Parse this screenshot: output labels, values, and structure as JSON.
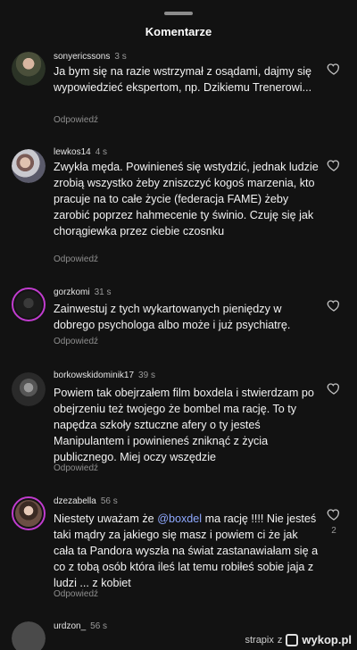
{
  "sheet": {
    "title": "Komentarze"
  },
  "reply_label": "Odpowiedź",
  "comments": [
    {
      "username": "sonyericssons",
      "time": "3 s",
      "text": "Ja bym się na razie wstrzymał z osądami, dajmy się wypowiedzieć ekspertom, np. Dzikiemu Trenerowi...",
      "likes": ""
    },
    {
      "username": "lewkos14",
      "time": "4 s",
      "text": "Zwykła męda. Powinieneś się wstydzić, jednak ludzie zrobią wszystko żeby zniszczyć kogoś marzenia, kto pracuje na to całe życie (federacja FAME) żeby zarobić poprzez hahmecenie ty świnio. Czuję się jak chorągiewka przez ciebie czosnku",
      "likes": ""
    },
    {
      "username": "gorzkomi",
      "time": "31 s",
      "text": "Zainwestuj z tych wykartowanych pieniędzy w dobrego psychologa albo może i już psychiatrę.",
      "likes": ""
    },
    {
      "username": "borkowskidominik17",
      "time": "39 s",
      "text": "Powiem tak obejrzałem film boxdela i stwierdzam po obejrzeniu też twojego że bombel ma rację. To ty napędza szkoły sztuczne afery o ty jesteś Manipulantem i powinieneś zniknąć z życia publicznego. Miej oczy wszędzie",
      "likes": ""
    },
    {
      "username": "dzezabella",
      "time": "56 s",
      "text_before": "Niestety uważam że ",
      "mention": "@boxdel",
      "text_after": " ma rację !!!! Nie jesteś taki mądry za jakiego się masz i powiem ci że jak cała ta Pandora wyszła na świat zastanawiałam się a co z tobą osób która ileś lat temu robiłeś sobie jaja z ludzi ... z kobiet",
      "likes": "2"
    },
    {
      "username": "urdzon_",
      "time": "56 s"
    }
  ],
  "footer": {
    "user": "strapix",
    "z": "z",
    "brand": "wykop.pl"
  },
  "colors": {
    "background": "#121212",
    "mention": "#8fa9ff",
    "story_ring": "#c13ccf"
  },
  "icons": {
    "like": "heart-icon",
    "brand": "wykop-logo-icon"
  }
}
